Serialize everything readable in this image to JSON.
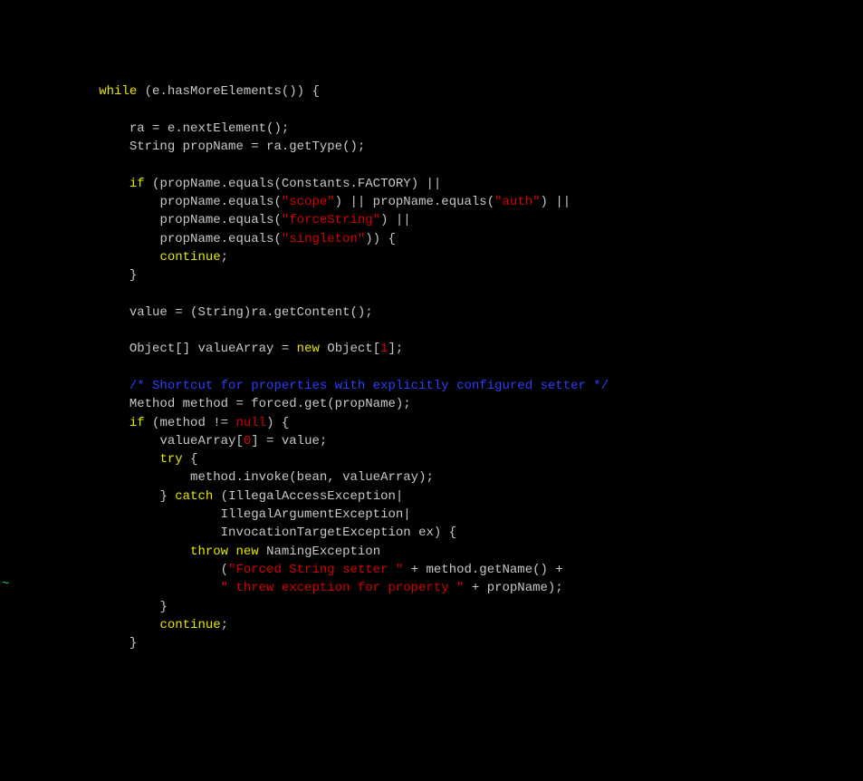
{
  "indent": {
    "i1": "             ",
    "i2": "                 ",
    "i3": "                     ",
    "i4": "                         ",
    "i5": "                             ",
    "i6": "                                 "
  },
  "t": {
    "while": "while",
    "if": "if",
    "continue": "continue",
    "new": "new",
    "null": "null",
    "try": "try",
    "catch": "catch",
    "throw": "throw",
    "num0": "0",
    "num1": "1"
  },
  "s": {
    "scope": "\"scope\"",
    "auth": "\"auth\"",
    "forceString": "\"forceString\"",
    "singleton": "\"singleton\"",
    "forced": "\"Forced String setter \"",
    "threw": "\" threw exception for property \""
  },
  "c": {
    "shortcut": "/* Shortcut for properties with explicitly configured setter */"
  },
  "p": {
    "l1a": " (e.hasMoreElements()) {",
    "l3": "ra = e.nextElement();",
    "l4": "String propName = ra.getType();",
    "l6a": " (propName.equals(Constants.FACTORY) ||",
    "l7a": "propName.equals(",
    "l7b": ") || propName.equals(",
    "l7c": ") ||",
    "l8b": ") ||",
    "l9b": ")) {",
    "semi": ";",
    "rbrace": "}",
    "l13": "value = (String)ra.getContent();",
    "l15a": "Object[] valueArray = ",
    "l15b": " Object[",
    "l15c": "];",
    "l18": "Method method = forced.get(propName);",
    "l19a": " (method != ",
    "l19b": ") {",
    "l20a": "valueArray[",
    "l20b": "] = value;",
    "l21a": " {",
    "l22": "method.invoke(bean, valueArray);",
    "l23a": "} ",
    "l23b": " (IllegalAccessException|",
    "l24": "IllegalArgumentException|",
    "l25": "InvocationTargetException ex) {",
    "l26b": " NamingException",
    "l27a": "(",
    "l27b": " + method.getName() +",
    "l28b": " + propName);",
    "space": " "
  },
  "cursor": "~"
}
